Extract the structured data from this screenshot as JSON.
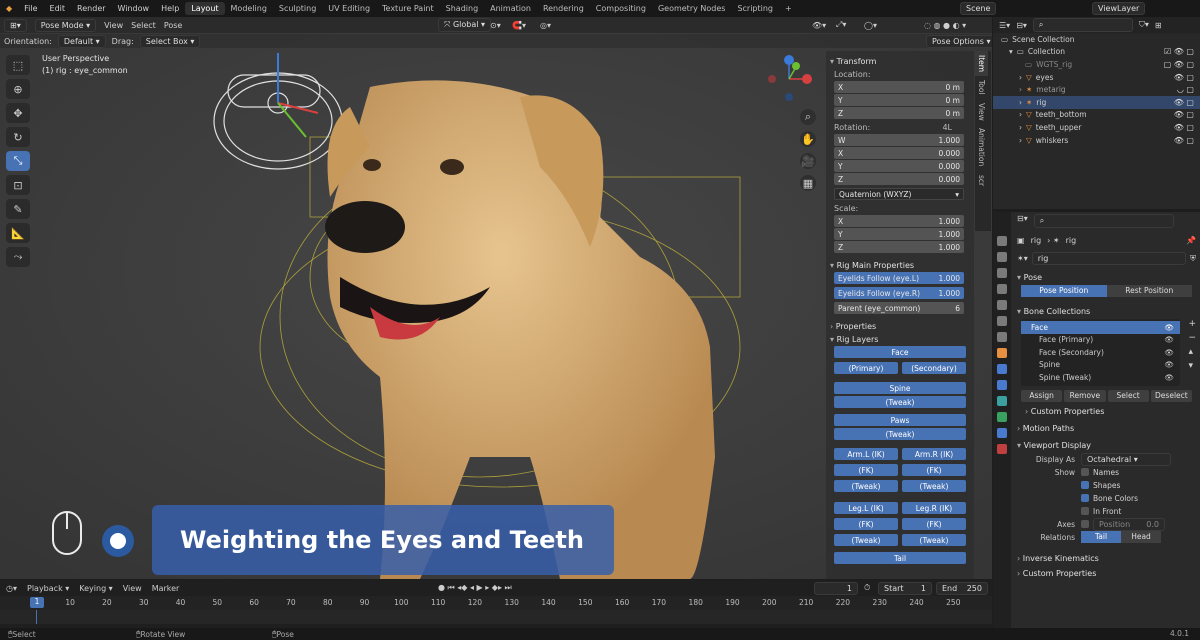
{
  "menu": [
    "File",
    "Edit",
    "Render",
    "Window",
    "Help"
  ],
  "workspaces": [
    "Layout",
    "Modeling",
    "Sculpting",
    "UV Editing",
    "Texture Paint",
    "Shading",
    "Animation",
    "Rendering",
    "Compositing",
    "Geometry Nodes",
    "Scripting",
    "+"
  ],
  "active_workspace": "Layout",
  "scene": "Scene",
  "view_layer": "ViewLayer",
  "viewport": {
    "mode": "Pose Mode",
    "view": "View",
    "select": "Select",
    "pose": "Pose",
    "transform_orientation": "Global",
    "orientation_label": "Orientation:",
    "orientation_value": "Default",
    "drag_label": "Drag:",
    "drag_value": "Select Box",
    "pose_options": "Pose Options",
    "perspective": "User Perspective",
    "object_info": "(1) rig : eye_common"
  },
  "caption": "Weighting the Eyes and Teeth",
  "npanel": {
    "transform": "Transform",
    "location_label": "Location:",
    "location": [
      {
        "axis": "X",
        "value": "0 m"
      },
      {
        "axis": "Y",
        "value": "0 m"
      },
      {
        "axis": "Z",
        "value": "0 m"
      }
    ],
    "rotation_label": "Rotation:",
    "rotation_lock": "4L",
    "rotation": [
      {
        "axis": "W",
        "value": "1.000"
      },
      {
        "axis": "X",
        "value": "0.000"
      },
      {
        "axis": "Y",
        "value": "0.000"
      },
      {
        "axis": "Z",
        "value": "0.000"
      }
    ],
    "rotation_mode": "Quaternion (WXYZ)",
    "scale_label": "Scale:",
    "scale": [
      {
        "axis": "X",
        "value": "1.000"
      },
      {
        "axis": "Y",
        "value": "1.000"
      },
      {
        "axis": "Z",
        "value": "1.000"
      }
    ],
    "rig_main": "Rig Main Properties",
    "eyelids_l": "Eyelids Follow (eye.L)",
    "eyelids_l_val": "1.000",
    "eyelids_r": "Eyelids Follow (eye.R)",
    "eyelids_r_val": "1.000",
    "parent": "Parent (eye_common)",
    "parent_val": "6",
    "properties": "Properties",
    "rig_layers": "Rig Layers",
    "face": "Face",
    "primary": "(Primary)",
    "secondary": "(Secondary)",
    "spine": "Spine",
    "tweak": "(Tweak)",
    "paws": "Paws",
    "arm_l_ik": "Arm.L (IK)",
    "arm_r_ik": "Arm.R (IK)",
    "fk": "(FK)",
    "leg_l_ik": "Leg.L (IK)",
    "leg_r_ik": "Leg.R (IK)",
    "tail": "Tail",
    "tabs": [
      "Item",
      "Tool",
      "View",
      "Animation",
      "scr"
    ]
  },
  "outliner": {
    "root": "Scene Collection",
    "collection": "Collection",
    "items": [
      "WGTS_rig",
      "eyes",
      "metarig",
      "rig",
      "teeth_bottom",
      "teeth_upper",
      "whiskers"
    ]
  },
  "props": {
    "rig": "rig",
    "rig2": "rig",
    "name": "rig",
    "pose": "Pose",
    "pose_position": "Pose Position",
    "rest_position": "Rest Position",
    "bone_collections": "Bone Collections",
    "collections": [
      "Face",
      "Face (Primary)",
      "Face (Secondary)",
      "Spine",
      "Spine (Tweak)"
    ],
    "assign": "Assign",
    "remove": "Remove",
    "select": "Select",
    "deselect": "Deselect",
    "custom_properties": "Custom Properties",
    "motion_paths": "Motion Paths",
    "viewport_display": "Viewport Display",
    "display_as_label": "Display As",
    "display_as": "Octahedral",
    "show_label": "Show",
    "names": "Names",
    "shapes": "Shapes",
    "bone_colors": "Bone Colors",
    "in_front": "In Front",
    "axes_label": "Axes",
    "position_label": "Position",
    "position_val": "0.0",
    "relations_label": "Relations",
    "tail": "Tail",
    "head": "Head",
    "inverse_kinematics": "Inverse Kinematics",
    "custom_properties2": "Custom Properties"
  },
  "timeline": {
    "playback": "Playback",
    "keying": "Keying",
    "view": "View",
    "marker": "Marker",
    "current": "1",
    "start_label": "Start",
    "start": "1",
    "end_label": "End",
    "end": "250",
    "ticks": [
      "10",
      "20",
      "30",
      "40",
      "50",
      "60",
      "70",
      "80",
      "90",
      "100",
      "110",
      "120",
      "130",
      "140",
      "150",
      "160",
      "170",
      "180",
      "190",
      "200",
      "210",
      "220",
      "230",
      "240",
      "250"
    ],
    "cursor": "1"
  },
  "status": {
    "select": "Select",
    "rotate": "Rotate View",
    "pose": "Pose",
    "version": "4.0.1"
  }
}
